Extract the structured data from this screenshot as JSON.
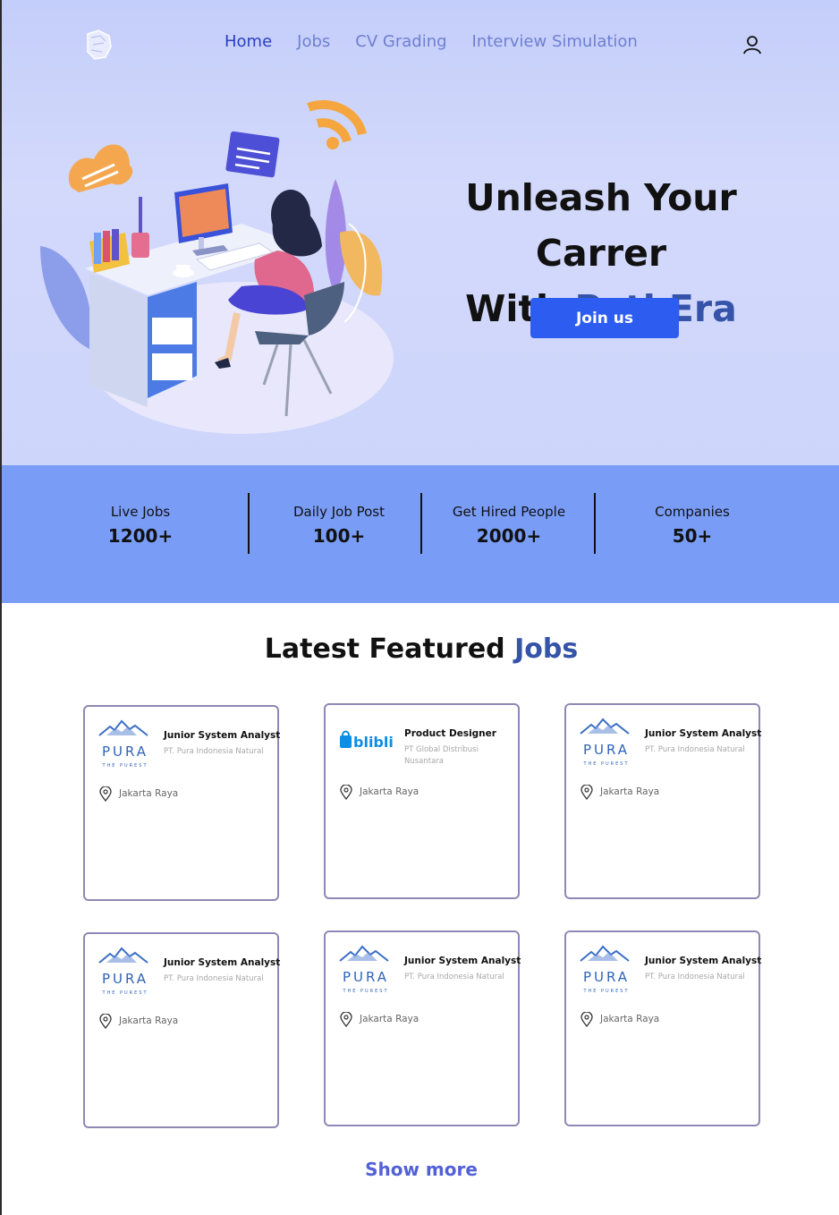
{
  "nav": {
    "items": [
      {
        "label": "Home",
        "active": true
      },
      {
        "label": "Jobs",
        "active": false
      },
      {
        "label": "CV Grading",
        "active": false
      },
      {
        "label": "Interview Simulation",
        "active": false
      }
    ],
    "logo_icon": "lion-logo-icon",
    "user_icon": "user-icon"
  },
  "hero": {
    "headline_line1": "Unleash Your Carrer",
    "headline_line2_prefix": "With ",
    "headline_brand": "PathEra",
    "cta_label": "Join us"
  },
  "stats": [
    {
      "label": "Live Jobs",
      "value": "1200+"
    },
    {
      "label": "Daily Job Post",
      "value": "100+"
    },
    {
      "label": "Get Hired People",
      "value": "2000+"
    },
    {
      "label": "Companies",
      "value": "50+"
    }
  ],
  "featured": {
    "title_prefix": "Latest Featured ",
    "title_accent": "Jobs",
    "show_more_label": "Show more",
    "jobs": [
      {
        "logo": "pura",
        "logo_text": "PURA",
        "logo_sub": "THE PUREST",
        "title": "Junior System Analyst",
        "company": "PT. Pura Indonesia Natural",
        "location": "Jakarta Raya"
      },
      {
        "logo": "blibli",
        "logo_text": "blibli",
        "logo_sub": "",
        "title": "Product Designer",
        "company": "PT Global Distribusi Nusantara",
        "location": "Jakarta Raya"
      },
      {
        "logo": "pura",
        "logo_text": "PURA",
        "logo_sub": "THE PUREST",
        "title": "Junior System Analyst",
        "company": "PT. Pura Indonesia Natural",
        "location": "Jakarta Raya"
      },
      {
        "logo": "pura",
        "logo_text": "PURA",
        "logo_sub": "THE PUREST",
        "title": "Junior System Analyst",
        "company": "PT. Pura Indonesia Natural",
        "location": "Jakarta Raya"
      },
      {
        "logo": "pura",
        "logo_text": "PURA",
        "logo_sub": "THE PUREST",
        "title": "Junior System Analyst",
        "company": "PT. Pura Indonesia Natural",
        "location": "Jakarta Raya"
      },
      {
        "logo": "pura",
        "logo_text": "PURA",
        "logo_sub": "THE PUREST",
        "title": "Junior System Analyst",
        "company": "PT. Pura Indonesia Natural",
        "location": "Jakarta Raya"
      }
    ]
  },
  "colors": {
    "brand": "#3553a8",
    "cta": "#2d5cf0",
    "stats_bg": "#799cf6",
    "hero_bg": "#c4cefa",
    "nav_active": "#2a3fc0",
    "nav_inactive": "#6e7fd0"
  }
}
